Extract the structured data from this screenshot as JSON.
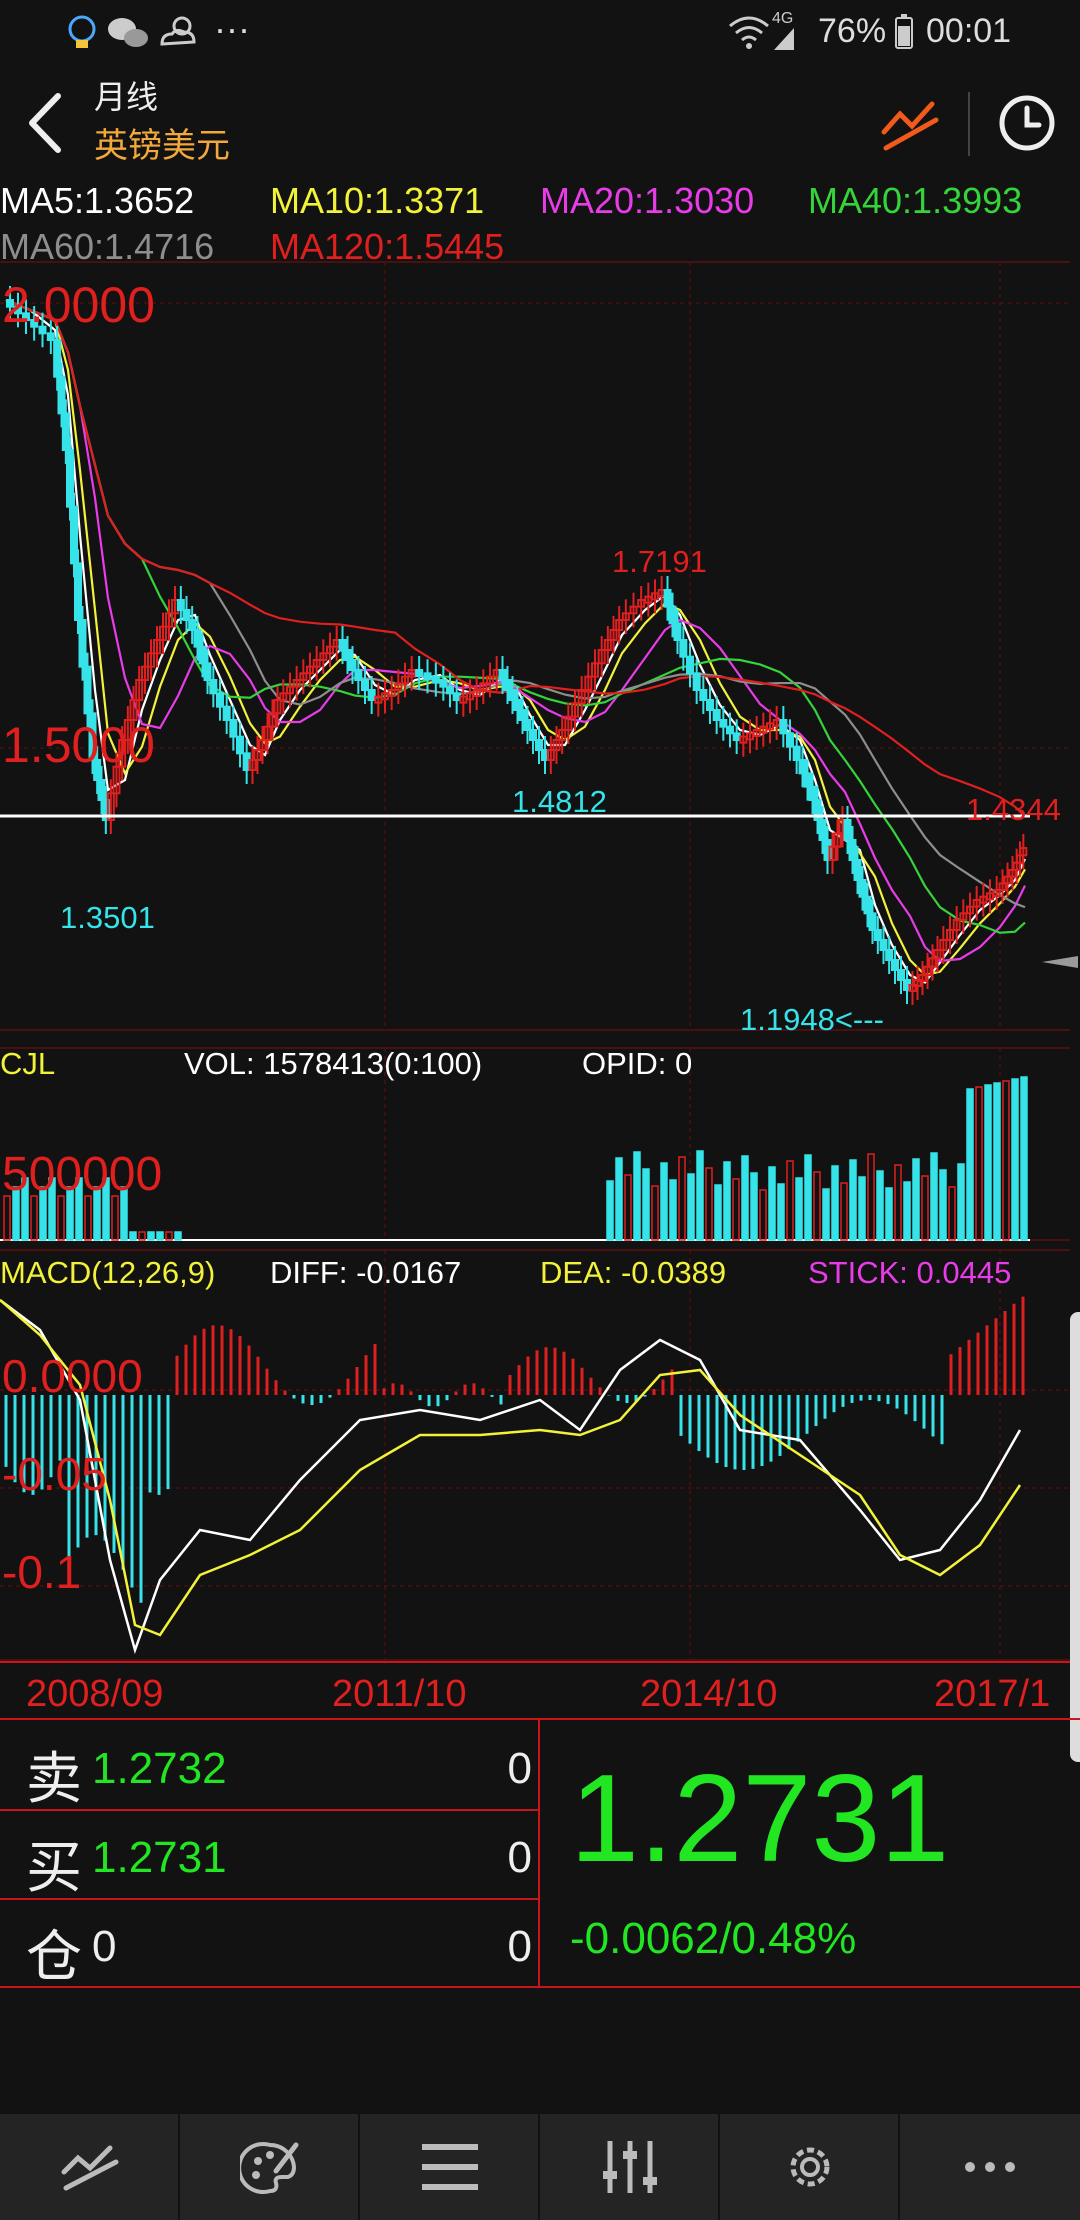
{
  "status_bar": {
    "network": "4G",
    "battery": "76%",
    "time": "00:01",
    "icons": [
      "qq-icon",
      "wechat-icon",
      "weather-icon",
      "more-dots-icon",
      "wifi-icon",
      "signal-icon",
      "battery-icon"
    ]
  },
  "header": {
    "period": "月线",
    "symbol": "英镑美元",
    "icons": [
      "back-arrow-icon",
      "chart-type-icon",
      "clock-icon"
    ]
  },
  "ma_legend": [
    {
      "text": "MA5:1.3652",
      "color": "#ffffff"
    },
    {
      "text": "MA10:1.3371",
      "color": "#f2f23a"
    },
    {
      "text": "MA20:1.3030",
      "color": "#e83ce8"
    },
    {
      "text": "MA40:1.3993",
      "color": "#35d43a"
    },
    {
      "text": "MA60:1.4716",
      "color": "#8e8e8e"
    },
    {
      "text": "MA120:1.5445",
      "color": "#e01f1f"
    }
  ],
  "price_axis": [
    "2.0000",
    "1.5000"
  ],
  "annotations": {
    "high": "1.7191",
    "low_left": "1.3501",
    "mid_low": "1.4812",
    "recent_low": "1.1948<---",
    "last_high": "1.4344"
  },
  "volume_panel": {
    "label": "CJL",
    "vol": "VOL: 1578413(0:100)",
    "opid": "OPID: 0",
    "axis": "500000"
  },
  "macd_panel": {
    "label": "MACD(12,26,9)",
    "diff": "DIFF: -0.0167",
    "dea": "DEA: -0.0389",
    "stick": "STICK: 0.0445",
    "axis": [
      "0.0000",
      "-0.05",
      "-0.1"
    ]
  },
  "x_axis": [
    "2008/09",
    "2011/10",
    "2014/10",
    "2017/1"
  ],
  "quote": {
    "sell_label": "卖",
    "sell_price": "1.2732",
    "sell_qty": "0",
    "buy_label": "买",
    "buy_price": "1.2731",
    "buy_qty": "0",
    "position_label": "仓",
    "position_value": "0",
    "position_qty": "0",
    "last_price": "1.2731",
    "change": "-0.0062/0.48%"
  },
  "colors": {
    "up": "#e01f1f",
    "down": "#35e3e8",
    "accent": "#f2a83a",
    "price_green": "#22e622",
    "grid": "#4a1010"
  },
  "bottom_nav": [
    "chart-icon",
    "palette-icon",
    "menu-icon",
    "sliders-icon",
    "gear-icon",
    "more-icon"
  ]
}
